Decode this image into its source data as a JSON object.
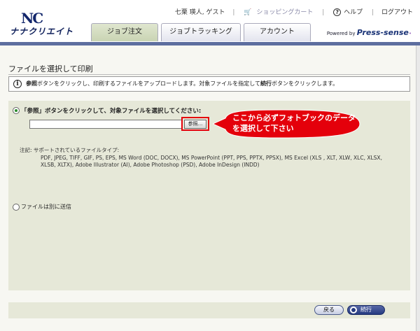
{
  "header": {
    "logo_mark": "NC",
    "logo_text": "ナナクリエイト",
    "user_greeting": "七栗 瑛人, ゲスト",
    "cart_label": "ショッピングカート",
    "help_label": "ヘルプ",
    "logout_label": "ログアウト",
    "powered_prefix": "Powered by",
    "powered_brand": "Press-sense"
  },
  "tabs": [
    {
      "label": "ジョブ注文",
      "active": true
    },
    {
      "label": "ジョブトラッキング",
      "active": false
    },
    {
      "label": "アカウント",
      "active": false
    }
  ],
  "page": {
    "title": "ファイルを選択して印刷",
    "info_bold1": "参照",
    "info_mid": "ボタンをクリックし、印刷するファイルをアップロードします。対象ファイルを指定して",
    "info_bold2": "続行",
    "info_end": "ボタンをクリックします。"
  },
  "upload": {
    "option1_label": "「参照」ボタンをクリックして、対象ファイルを選択してください:",
    "file_value": "",
    "browse_label": "参照...",
    "callout_text": "ここから必ずフォトブックのデータを選択して下さい",
    "notes_label": "注記: サポートされているファイルタイプ:",
    "notes_list": "PDF, JPEG, TIFF, GIF, PS, EPS, MS Word (DOC, DOCX), MS PowerPoint (PPT, PPS, PPTX, PPSX), MS Excel (XLS , XLT, XLW, XLC, XLSX, XLSB, XLTX), Adobe Illustrator (AI), Adobe Photoshop (PSD), Adobe InDesign (INDD)",
    "option2_label": "ファイルは別に送信"
  },
  "footer": {
    "back_label": "戻る",
    "next_label": "続行"
  },
  "colors": {
    "accent_blue": "#5d6e9f",
    "panel_bg": "#e6e8d8",
    "highlight_red": "#e4000b"
  }
}
